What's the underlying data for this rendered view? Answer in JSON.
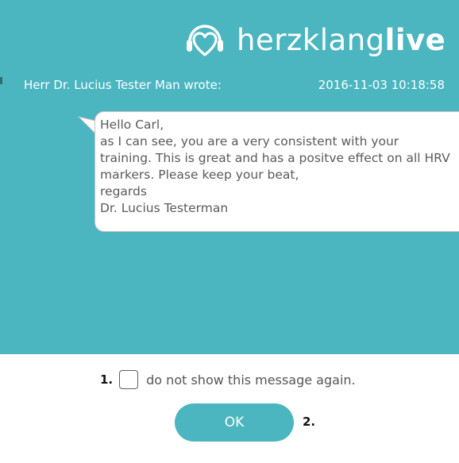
{
  "brand": {
    "name_light": "herzklang",
    "name_bold": "live",
    "logo_icon": "heart-headphones-icon"
  },
  "message": {
    "sender": "Herr Dr. Lucius Tester Man wrote:",
    "timestamp": "2016-11-03 10:18:58",
    "lines": [
      "Hello Carl,",
      "as I can see, you are a very consistent with your",
      "training. This is great and has a positve effect on all HRV",
      "markers. Please keep your beat,",
      "regards",
      "Dr. Lucius Testerman"
    ]
  },
  "footer": {
    "step1": "1.",
    "checkbox_label": "do not show this message again.",
    "checkbox_checked": false,
    "ok_label": "OK",
    "step2": "2."
  },
  "colors": {
    "teal": "#4bb6c0",
    "bubble_text": "#5a5a5a"
  }
}
